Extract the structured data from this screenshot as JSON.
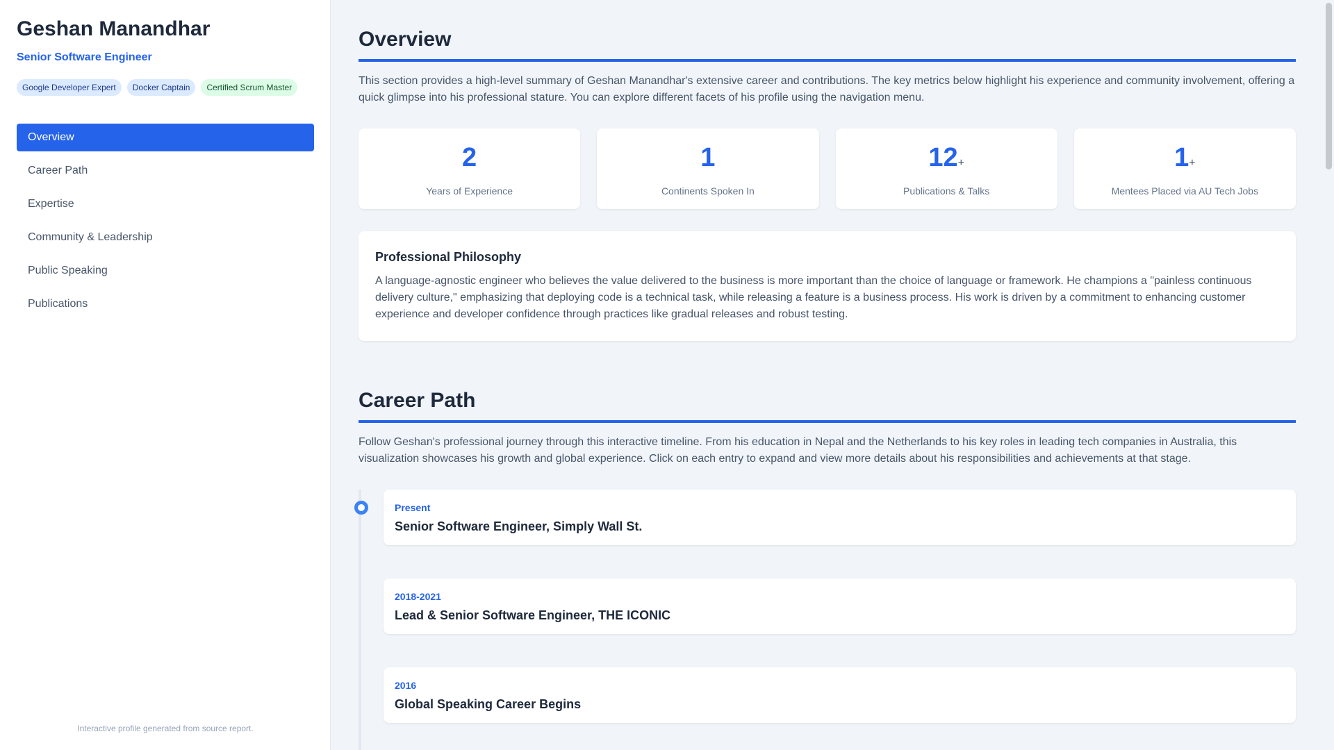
{
  "profile": {
    "name": "Geshan Manandhar",
    "role": "Senior Software Engineer",
    "badges": [
      "Google Developer Expert",
      "Docker Captain",
      "Certified Scrum Master"
    ]
  },
  "nav": {
    "items": [
      "Overview",
      "Career Path",
      "Expertise",
      "Community & Leadership",
      "Public Speaking",
      "Publications"
    ],
    "active": "Overview"
  },
  "footer": "Interactive profile generated from source report.",
  "overview": {
    "title": "Overview",
    "intro": "This section provides a high-level summary of Geshan Manandhar's extensive career and contributions. The key metrics below highlight his experience and community involvement, offering a quick glimpse into his professional stature. You can explore different facets of his profile using the navigation menu.",
    "stats": [
      {
        "value": "2",
        "suffix": "",
        "label": "Years of Experience"
      },
      {
        "value": "1",
        "suffix": "",
        "label": "Continents Spoken In"
      },
      {
        "value": "12",
        "suffix": "+",
        "label": "Publications & Talks"
      },
      {
        "value": "1",
        "suffix": "+",
        "label": "Mentees Placed via AU Tech Jobs"
      }
    ],
    "philosophy": {
      "title": "Professional Philosophy",
      "text": "A language-agnostic engineer who believes the value delivered to the business is more important than the choice of language or framework. He champions a \"painless continuous delivery culture,\" emphasizing that deploying code is a technical task, while releasing a feature is a business process. His work is driven by a commitment to enhancing customer experience and developer confidence through practices like gradual releases and robust testing."
    }
  },
  "career": {
    "title": "Career Path",
    "intro": "Follow Geshan's professional journey through this interactive timeline. From his education in Nepal and the Netherlands to his key roles in leading tech companies in Australia, this visualization showcases his growth and global experience. Click on each entry to expand and view more details about his responsibilities and achievements at that stage.",
    "timeline": [
      {
        "date": "Present",
        "title": "Senior Software Engineer, Simply Wall St."
      },
      {
        "date": "2018-2021",
        "title": "Lead & Senior Software Engineer, THE ICONIC"
      },
      {
        "date": "2016",
        "title": "Global Speaking Career Begins"
      }
    ]
  },
  "colors": {
    "accent": "#2563eb",
    "background": "#f1f5f9"
  }
}
